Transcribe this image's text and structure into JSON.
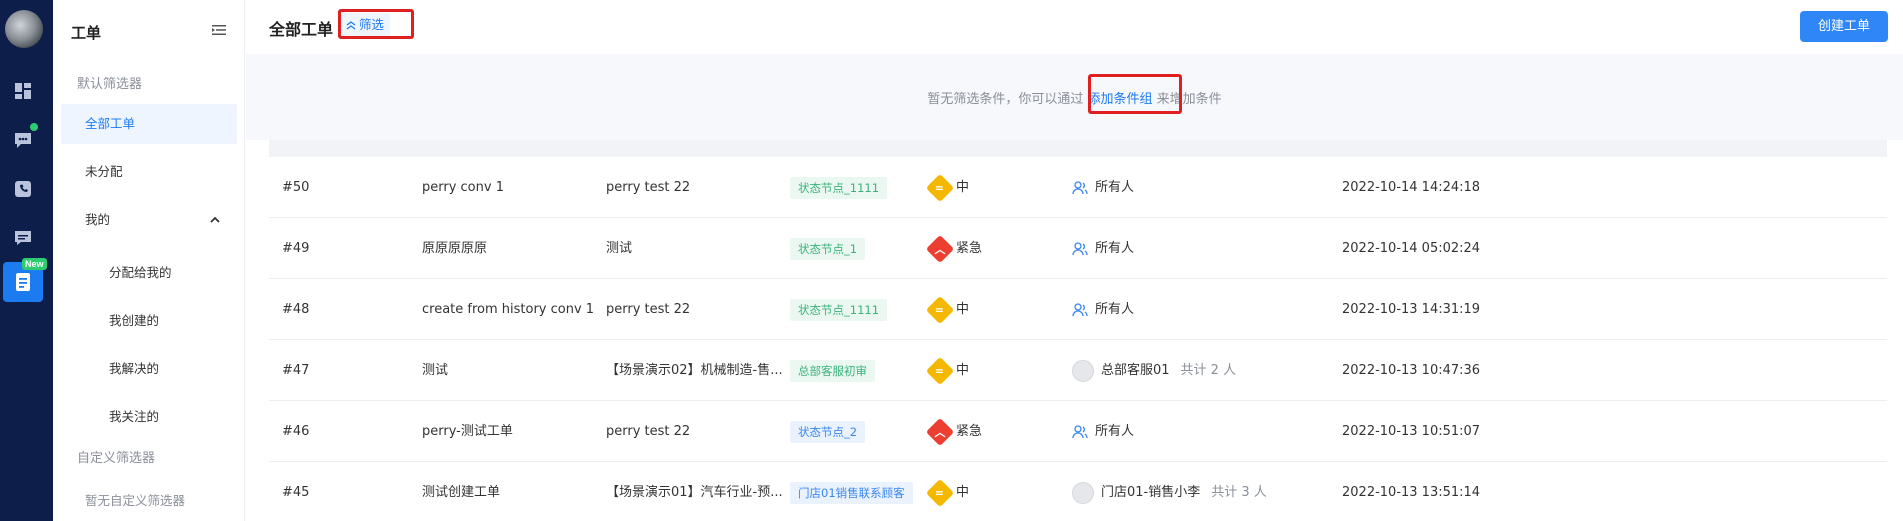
{
  "sidebar": {
    "title": "工单",
    "default_filters_label": "默认筛选器",
    "items": [
      {
        "label": "全部工单"
      },
      {
        "label": "未分配"
      },
      {
        "label": "我的"
      }
    ],
    "my_sub_items": [
      {
        "label": "分配给我的"
      },
      {
        "label": "我创建的"
      },
      {
        "label": "我解决的"
      },
      {
        "label": "我关注的"
      }
    ],
    "custom_filters_label": "自定义筛选器",
    "no_custom_filters": "暂无自定义筛选器"
  },
  "rail": {
    "new_badge": "New"
  },
  "header": {
    "title": "全部工单",
    "filter_button": "筛选",
    "create_button": "创建工单"
  },
  "filter_panel": {
    "message_before": "暂无筛选条件，你可以通过",
    "link": "添加条件组",
    "message_after": "来增加条件"
  },
  "rows": [
    {
      "id": "#50",
      "title": "perry conv 1",
      "customer": "perry test 22",
      "status": "状态节点_1111",
      "status_color": "green",
      "priority": "中",
      "priority_level": "mid",
      "assignee": "所有人",
      "assignee_type": "group",
      "count": "",
      "time": "2022-10-14 14:24:18"
    },
    {
      "id": "#49",
      "title": "原原原原原",
      "customer": "测试",
      "status": "状态节点_1",
      "status_color": "green",
      "priority": "紧急",
      "priority_level": "urgent",
      "assignee": "所有人",
      "assignee_type": "group",
      "count": "",
      "time": "2022-10-14 05:02:24"
    },
    {
      "id": "#48",
      "title": "create from history conv 1",
      "customer": "perry test 22",
      "status": "状态节点_1111",
      "status_color": "green",
      "priority": "中",
      "priority_level": "mid",
      "assignee": "所有人",
      "assignee_type": "group",
      "count": "",
      "time": "2022-10-13 14:31:19"
    },
    {
      "id": "#47",
      "title": "测试",
      "customer": "【场景演示02】机械制造-售...",
      "status": "总部客服初审",
      "status_color": "green",
      "priority": "中",
      "priority_level": "mid",
      "assignee": "总部客服01",
      "assignee_type": "user",
      "count": "共计 2 人",
      "time": "2022-10-13 10:47:36"
    },
    {
      "id": "#46",
      "title": "perry-测试工单",
      "customer": "perry test 22",
      "status": "状态节点_2",
      "status_color": "blue",
      "priority": "紧急",
      "priority_level": "urgent",
      "assignee": "所有人",
      "assignee_type": "group",
      "count": "",
      "time": "2022-10-13 10:51:07"
    },
    {
      "id": "#45",
      "title": "测试创建工单",
      "customer": "【场景演示01】汽车行业-预...",
      "status": "门店01销售联系顾客",
      "status_color": "blue",
      "priority": "中",
      "priority_level": "mid",
      "assignee": "门店01-销售小李",
      "assignee_type": "user",
      "count": "共计 3 人",
      "time": "2022-10-13 13:51:14"
    }
  ],
  "colors": {
    "rail_bg": "#0e1e4a",
    "accent": "#1d7bf0",
    "highlight": "#e02020"
  }
}
